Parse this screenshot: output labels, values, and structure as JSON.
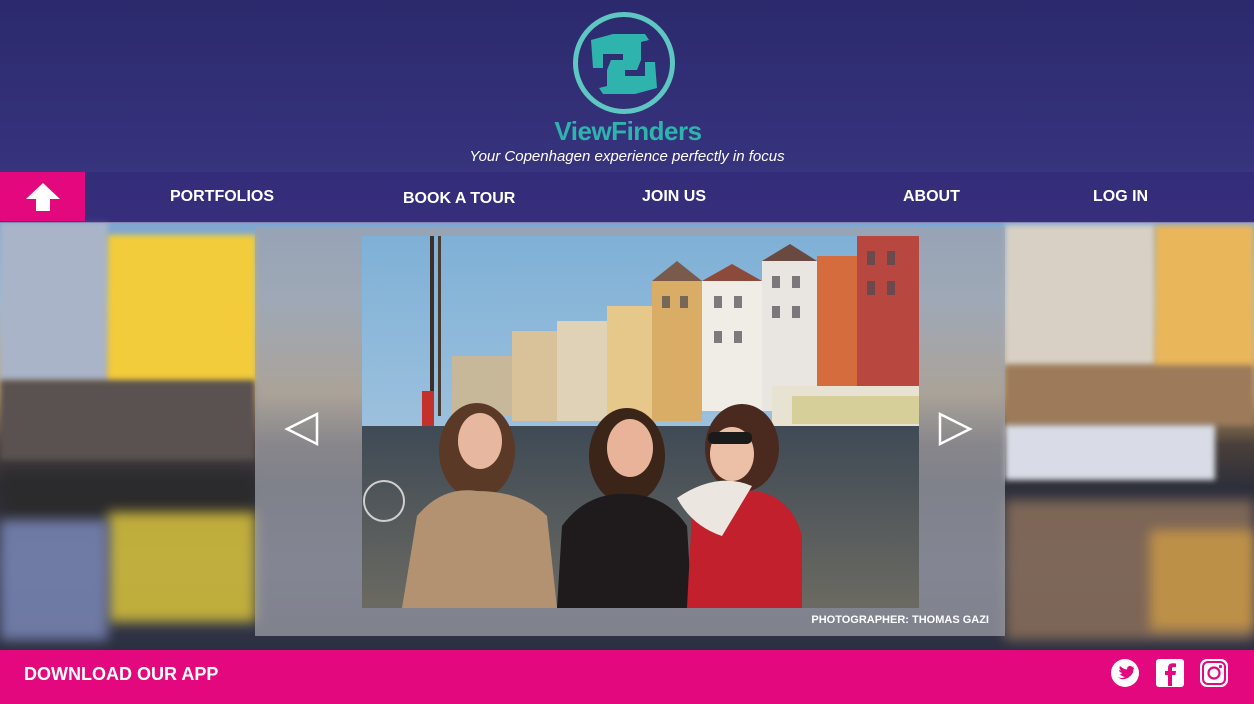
{
  "header": {
    "brand": "ViewFinders",
    "tagline": "Your Copenhagen experience perfectly in focus"
  },
  "nav": {
    "home_icon": "up-arrow-icon",
    "items": [
      "PORTFOLIOS",
      "BOOK A TOUR",
      "JOIN US",
      "ABOUT",
      "LOG IN"
    ]
  },
  "gallery": {
    "credit": "PHOTOGRAPHER: THOMAS GAZI",
    "prev_icon": "triangle-left-icon",
    "next_icon": "triangle-right-icon"
  },
  "footer": {
    "download": "DOWNLOAD OUR APP",
    "social_icons": [
      "twitter-icon",
      "facebook-icon",
      "instagram-icon"
    ]
  },
  "colors": {
    "accent_pink": "#e3087e",
    "brand_teal": "#2fb3ad",
    "nav_purple": "#322a78"
  }
}
